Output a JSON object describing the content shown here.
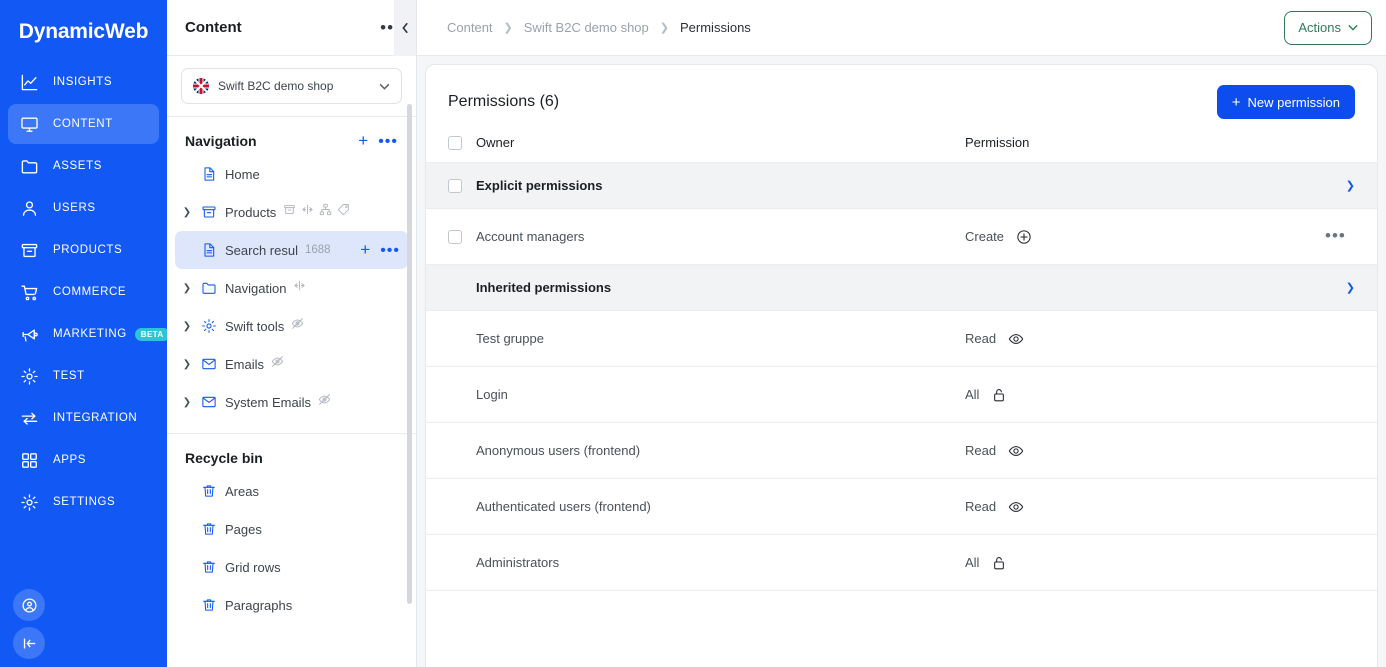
{
  "rail": {
    "logo": "DynamicWeb",
    "items": [
      {
        "label": "INSIGHTS",
        "icon": "chart-line-icon",
        "active": false
      },
      {
        "label": "CONTENT",
        "icon": "monitor-icon",
        "active": true
      },
      {
        "label": "ASSETS",
        "icon": "folder-icon",
        "active": false
      },
      {
        "label": "USERS",
        "icon": "user-icon",
        "active": false
      },
      {
        "label": "PRODUCTS",
        "icon": "archive-icon",
        "active": false
      },
      {
        "label": "COMMERCE",
        "icon": "cart-icon",
        "active": false
      },
      {
        "label": "MARKETING",
        "icon": "megaphone-icon",
        "active": false,
        "badge": "BETA"
      },
      {
        "label": "TEST",
        "icon": "gear-icon",
        "active": false
      },
      {
        "label": "INTEGRATION",
        "icon": "exchange-icon",
        "active": false
      },
      {
        "label": "APPS",
        "icon": "grid-icon",
        "active": false
      },
      {
        "label": "SETTINGS",
        "icon": "gear-icon",
        "active": false
      }
    ],
    "bottom": [
      {
        "icon": "account-circle-icon",
        "name": "account-button"
      },
      {
        "icon": "collapse-panel-icon",
        "name": "collapse-rail-button"
      }
    ],
    "colors": {
      "bg": "#1158f5",
      "active_bg": "#3b77f7",
      "badge_bg": "#2ec4d8"
    }
  },
  "navpanel": {
    "title": "Content",
    "overflow_label": "•••",
    "shop_selector": {
      "label": "Swift B2C demo shop",
      "flag": "uk-flag-icon"
    },
    "navigation": {
      "section_title": "Navigation",
      "items": [
        {
          "label": "Home",
          "icon": "page-icon",
          "caret": false,
          "badges": [],
          "count": "",
          "selected": false
        },
        {
          "label": "Products",
          "icon": "archive-icon",
          "caret": true,
          "badges": [
            "archive-icon",
            "arrows-horizontal-icon",
            "sitemap-icon",
            "tag-icon"
          ],
          "count": "",
          "selected": false
        },
        {
          "label": "Search resul",
          "icon": "page-icon",
          "caret": false,
          "badges": [],
          "count": "1688",
          "selected": true
        },
        {
          "label": "Navigation",
          "icon": "folder-icon",
          "caret": true,
          "badges": [
            "arrows-horizontal-icon"
          ],
          "count": "",
          "selected": false
        },
        {
          "label": "Swift tools",
          "icon": "gear-icon",
          "caret": true,
          "badges": [
            "eye-off-icon"
          ],
          "count": "",
          "selected": false
        },
        {
          "label": "Emails",
          "icon": "mail-icon",
          "caret": true,
          "badges": [
            "eye-off-icon"
          ],
          "count": "",
          "selected": false
        },
        {
          "label": "System Emails",
          "icon": "mail-icon",
          "caret": true,
          "badges": [
            "eye-off-icon"
          ],
          "count": "",
          "selected": false
        }
      ]
    },
    "recycle_bin": {
      "section_title": "Recycle bin",
      "items": [
        {
          "label": "Areas",
          "icon": "trash-icon"
        },
        {
          "label": "Pages",
          "icon": "trash-icon"
        },
        {
          "label": "Grid rows",
          "icon": "trash-icon"
        },
        {
          "label": "Paragraphs",
          "icon": "trash-icon"
        }
      ]
    }
  },
  "topbar": {
    "breadcrumbs": [
      {
        "label": "Content",
        "current": false
      },
      {
        "label": "Swift B2C demo shop",
        "current": false
      },
      {
        "label": "Permissions",
        "current": true
      }
    ],
    "actions_label": "Actions",
    "actions_color": "#2e7d5a"
  },
  "permissions_panel": {
    "title": "Permissions (6)",
    "new_button_label": "New permission",
    "new_button_color": "#0d4df0",
    "columns": {
      "owner": "Owner",
      "permission": "Permission"
    },
    "groups": [
      {
        "name": "Explicit permissions",
        "has_checkbox": true,
        "expanded": true,
        "rows": [
          {
            "owner": "Account managers",
            "permission": "Create",
            "permission_icon": "plus-circle-icon",
            "has_checkbox": true,
            "has_menu": true
          }
        ]
      },
      {
        "name": "Inherited permissions",
        "has_checkbox": false,
        "expanded": true,
        "rows": [
          {
            "owner": "Test gruppe",
            "permission": "Read",
            "permission_icon": "eye-icon",
            "has_checkbox": false,
            "has_menu": false
          },
          {
            "owner": "Login",
            "permission": "All",
            "permission_icon": "lock-open-icon",
            "has_checkbox": false,
            "has_menu": false
          },
          {
            "owner": "Anonymous users (frontend)",
            "permission": "Read",
            "permission_icon": "eye-icon",
            "has_checkbox": false,
            "has_menu": false
          },
          {
            "owner": "Authenticated users (frontend)",
            "permission": "Read",
            "permission_icon": "eye-icon",
            "has_checkbox": false,
            "has_menu": false
          },
          {
            "owner": "Administrators",
            "permission": "All",
            "permission_icon": "lock-open-icon",
            "has_checkbox": false,
            "has_menu": false
          }
        ]
      }
    ]
  }
}
